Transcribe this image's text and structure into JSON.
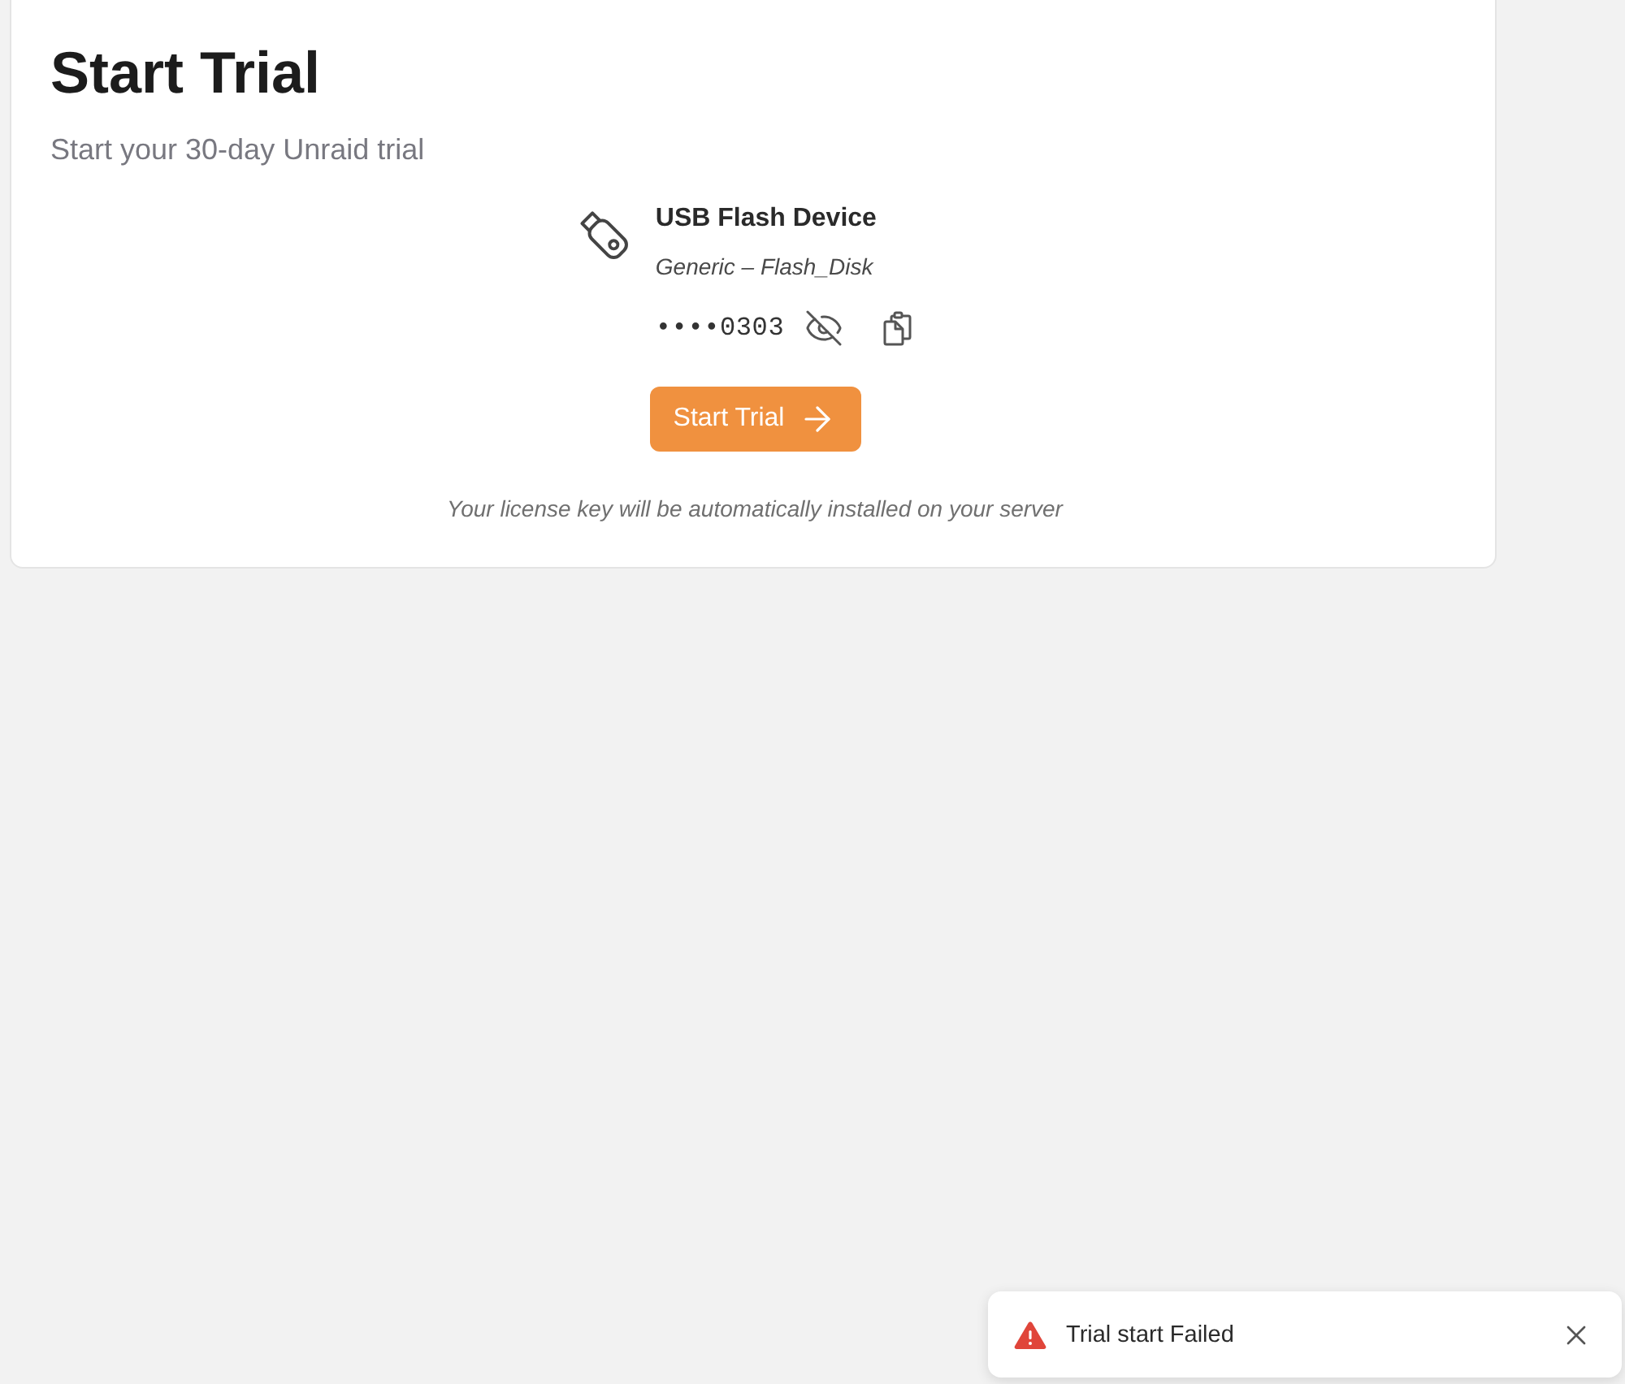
{
  "page": {
    "title": "Start Trial",
    "subtitle": "Start your 30-day Unraid trial"
  },
  "device": {
    "name": "USB Flash Device",
    "model": "Generic – Flash_Disk",
    "key": "••••0303",
    "key_revealed": false
  },
  "button": {
    "label": "Start Trial"
  },
  "note": "Your license key will be automatically installed on your server",
  "toast": {
    "kind": "error",
    "message": "Trial start Failed"
  }
}
